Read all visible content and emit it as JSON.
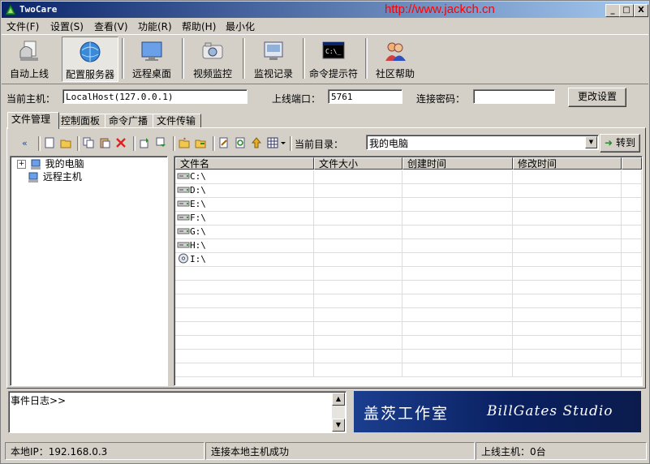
{
  "window": {
    "title": "TwoCare",
    "watermark_url": "http://www.jackch.cn",
    "controls": [
      "_",
      "□",
      "X"
    ]
  },
  "menu": [
    "文件(F)",
    "设置(S)",
    "查看(V)",
    "功能(R)",
    "帮助(H)",
    "最小化"
  ],
  "toolbar": [
    {
      "label": "自动上线",
      "icon": "auto-online-icon"
    },
    {
      "label": "配置服务器",
      "icon": "globe-config-icon"
    },
    {
      "label": "远程桌面",
      "icon": "monitor-icon"
    },
    {
      "label": "视频监控",
      "icon": "camera-icon"
    },
    {
      "label": "监视记录",
      "icon": "screen-record-icon"
    },
    {
      "label": "命令提示符",
      "icon": "cmd-icon"
    },
    {
      "label": "社区帮助",
      "icon": "community-icon"
    }
  ],
  "connection": {
    "host_label": "当前主机：",
    "host_value": "LocalHost(127.0.0.1)",
    "port_label": "上线端口：",
    "port_value": "5761",
    "password_label": "连接密码：",
    "password_value": "",
    "apply_button": "更改设置"
  },
  "tabs": [
    "文件管理",
    "控制面板",
    "命令广播",
    "文件传输"
  ],
  "file_toolbar": {
    "dir_label": "当前目录：",
    "dir_value": "我的电脑",
    "go_button": "转到"
  },
  "tree": [
    {
      "label": "我的电脑",
      "expander": "+"
    },
    {
      "label": "远程主机"
    }
  ],
  "file_list": {
    "columns": [
      "文件名",
      "文件大小",
      "创建时间",
      "修改时间"
    ],
    "rows": [
      {
        "name": "C:\\",
        "icon": "drive-icon"
      },
      {
        "name": "D:\\",
        "icon": "drive-icon"
      },
      {
        "name": "E:\\",
        "icon": "drive-icon"
      },
      {
        "name": "F:\\",
        "icon": "drive-icon"
      },
      {
        "name": "G:\\",
        "icon": "drive-icon"
      },
      {
        "name": "H:\\",
        "icon": "drive-icon"
      },
      {
        "name": "I:\\",
        "icon": "cdrom-icon"
      }
    ]
  },
  "log": {
    "text": "事件日志>>"
  },
  "banner": {
    "cn": "盖茨工作室",
    "en": "BillGates Studio"
  },
  "status": {
    "local_ip": "本地IP：192.168.0.3",
    "message": "连接本地主机成功",
    "online": "上线主机：0台"
  }
}
